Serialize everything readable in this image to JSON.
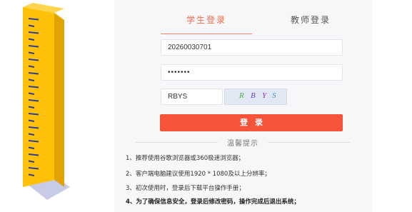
{
  "tabs": {
    "student": "学生登录",
    "teacher": "教师登录"
  },
  "form": {
    "username_value": "20260030701",
    "password_value": "•••••••",
    "captcha_value": "RBYS",
    "captcha_chars": [
      "R",
      "B",
      "Y",
      "S"
    ],
    "captcha_colors": [
      "#4caf50",
      "#6a3fb5",
      "#9c27b0",
      "#26a0da"
    ],
    "login_label": "登录"
  },
  "tips": {
    "title": "温馨提示",
    "items": [
      "1、推荐使用谷歌浏览器或360极速浏览器；",
      "2、客户端电脑建议使用1920 * 1080及以上分辨率；",
      "3、初次使用时，登录后下载平台操作手册；",
      "4、为了确保信息安全，登录后修改密码，操作完成后退出系统；"
    ]
  },
  "colors": {
    "accent": "#f5543a",
    "ruler_yellow": "#ffc107",
    "ruler_marks": "#2f3f8f"
  },
  "icons": {
    "ruler": "ruler-illustration"
  }
}
